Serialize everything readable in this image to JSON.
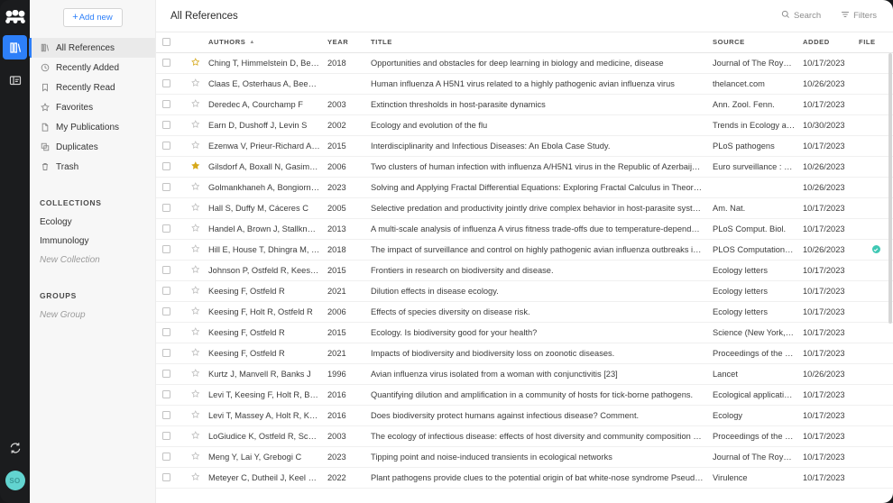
{
  "rail": {
    "logo_icon": "mendeley-logo-icon",
    "buttons": [
      {
        "name": "library-icon",
        "label": "Library",
        "active": true
      },
      {
        "name": "notebook-icon",
        "label": "Notebook",
        "active": false
      }
    ],
    "sync_icon": "sync-icon",
    "avatar_initials": "SO",
    "accent_color": "#2d7ff9",
    "avatar_color": "#62d4d0"
  },
  "sidebar": {
    "add_new_label": "Add new",
    "add_new_plus": "+",
    "nav_items": [
      {
        "label": "All References",
        "icon": "library-icon",
        "selected": true
      },
      {
        "label": "Recently Added",
        "icon": "clock-icon",
        "selected": false
      },
      {
        "label": "Recently Read",
        "icon": "bookmark-icon",
        "selected": false
      },
      {
        "label": "Favorites",
        "icon": "star-icon",
        "selected": false
      },
      {
        "label": "My Publications",
        "icon": "document-icon",
        "selected": false
      },
      {
        "label": "Duplicates",
        "icon": "copy-icon",
        "selected": false
      },
      {
        "label": "Trash",
        "icon": "trash-icon",
        "selected": false
      }
    ],
    "collections_heading": "COLLECTIONS",
    "collections": [
      {
        "label": "Ecology",
        "muted": false
      },
      {
        "label": "Immunology",
        "muted": false
      },
      {
        "label": "New Collection",
        "muted": true
      }
    ],
    "groups_heading": "GROUPS",
    "groups": [
      {
        "label": "New Group",
        "muted": true
      }
    ]
  },
  "topbar": {
    "title": "All References",
    "search_label": "Search",
    "search_icon": "search-icon",
    "filters_label": "Filters",
    "filters_icon": "filter-icon"
  },
  "table": {
    "columns": {
      "authors": "AUTHORS",
      "year": "YEAR",
      "title": "TITLE",
      "source": "SOURCE",
      "added": "ADDED",
      "file": "FILE"
    },
    "sort_column": "AUTHORS",
    "sort_direction": "asc",
    "sort_caret": "▲",
    "rows": [
      {
        "authors": "Ching T, Himmelstein D, Beauli…",
        "year": "2018",
        "title": "Opportunities and obstacles for deep learning in biology and medicine, disease",
        "source": "Journal of The Royal S…",
        "added": "10/17/2023",
        "unread": true,
        "starred": "outline-gold",
        "file": false
      },
      {
        "authors": "Claas E, Osterhaus A, Beek R, …",
        "year": "",
        "title": "Human influenza A H5N1 virus related to a highly pathogenic avian influenza virus",
        "source": "thelancet.com",
        "added": "10/26/2023",
        "unread": true,
        "starred": "outline",
        "file": false
      },
      {
        "authors": "Deredec A, Courchamp F",
        "year": "2003",
        "title": "Extinction thresholds in host-parasite dynamics",
        "source": "Ann. Zool. Fenn.",
        "added": "10/17/2023",
        "unread": true,
        "starred": "outline",
        "file": false
      },
      {
        "authors": "Earn D, Dushoff J, Levin S",
        "year": "2002",
        "title": "Ecology and evolution of the flu",
        "source": "Trends in Ecology and …",
        "added": "10/30/2023",
        "unread": true,
        "starred": "outline",
        "file": false
      },
      {
        "authors": "Ezenwa V, Prieur-Richard A, Ro…",
        "year": "2015",
        "title": "Interdisciplinarity and Infectious Diseases: An Ebola Case Study.",
        "source": "PLoS pathogens",
        "added": "10/17/2023",
        "unread": true,
        "starred": "outline",
        "file": false
      },
      {
        "authors": "Gilsdorf A, Boxall N, Gasimov V…",
        "year": "2006",
        "title": "Two clusters of human infection with influenza A/H5N1 virus in the Republic of Azerbaijan, Febr…",
        "source": "Euro surveillance : bull…",
        "added": "10/26/2023",
        "unread": true,
        "starred": "filled-gold",
        "file": false
      },
      {
        "authors": "Golmankhaneh A, Bongiorno D",
        "year": "2023",
        "title": "Solving and Applying Fractal Differential Equations: Exploring Fractal Calculus in Theory and Pr…",
        "source": "",
        "added": "10/26/2023",
        "unread": true,
        "starred": "outline",
        "file": false
      },
      {
        "authors": "Hall S, Duffy M, Cáceres C",
        "year": "2005",
        "title": "Selective predation and productivity jointly drive complex behavior in host-parasite systems",
        "source": "Am. Nat.",
        "added": "10/17/2023",
        "unread": true,
        "starred": "outline",
        "file": false
      },
      {
        "authors": "Handel A, Brown J, Stallknecht …",
        "year": "2013",
        "title": "A multi-scale analysis of influenza A virus fitness trade-offs due to temperature-dependent virus …",
        "source": "PLoS Comput. Biol.",
        "added": "10/17/2023",
        "unread": true,
        "starred": "outline",
        "file": false
      },
      {
        "authors": "Hill E, House T, Dhingra M, Kal…",
        "year": "2018",
        "title": "The impact of surveillance and control on highly pathogenic avian influenza outbreaks in poultry…",
        "source": "PLOS Computational B…",
        "added": "10/26/2023",
        "unread": true,
        "starred": "outline",
        "file": true
      },
      {
        "authors": "Johnson P, Ostfeld R, Keesing F",
        "year": "2015",
        "title": "Frontiers in research on biodiversity and disease.",
        "source": "Ecology letters",
        "added": "10/17/2023",
        "unread": true,
        "starred": "outline",
        "file": false
      },
      {
        "authors": "Keesing F, Ostfeld R",
        "year": "2021",
        "title": "Dilution effects in disease ecology.",
        "source": "Ecology letters",
        "added": "10/17/2023",
        "unread": true,
        "starred": "outline",
        "file": false
      },
      {
        "authors": "Keesing F, Holt R, Ostfeld R",
        "year": "2006",
        "title": "Effects of species diversity on disease risk.",
        "source": "Ecology letters",
        "added": "10/17/2023",
        "unread": true,
        "starred": "outline",
        "file": false
      },
      {
        "authors": "Keesing F, Ostfeld R",
        "year": "2015",
        "title": "Ecology. Is biodiversity good for your health?",
        "source": "Science (New York, N.Y.)",
        "added": "10/17/2023",
        "unread": true,
        "starred": "outline",
        "file": false
      },
      {
        "authors": "Keesing F, Ostfeld R",
        "year": "2021",
        "title": "Impacts of biodiversity and biodiversity loss on zoonotic diseases.",
        "source": "Proceedings of the Nati…",
        "added": "10/17/2023",
        "unread": true,
        "starred": "outline",
        "file": false
      },
      {
        "authors": "Kurtz J, Manvell R, Banks J",
        "year": "1996",
        "title": "Avian influenza virus isolated from a woman with conjunctivitis [23]",
        "source": "Lancet",
        "added": "10/26/2023",
        "unread": true,
        "starred": "outline",
        "file": false
      },
      {
        "authors": "Levi T, Keesing F, Holt R, Barfie…",
        "year": "2016",
        "title": "Quantifying dilution and amplification in a community of hosts for tick-borne pathogens.",
        "source": "Ecological applications …",
        "added": "10/17/2023",
        "unread": true,
        "starred": "outline",
        "file": false
      },
      {
        "authors": "Levi T, Massey A, Holt R, Keesi…",
        "year": "2016",
        "title": "Does biodiversity protect humans against infectious disease? Comment.",
        "source": "Ecology",
        "added": "10/17/2023",
        "unread": true,
        "starred": "outline",
        "file": false
      },
      {
        "authors": "LoGiudice K, Ostfeld R, Schmid…",
        "year": "2003",
        "title": "The ecology of infectious disease: effects of host diversity and community composition on Lyme…",
        "source": "Proceedings of the Nati…",
        "added": "10/17/2023",
        "unread": true,
        "starred": "outline",
        "file": false
      },
      {
        "authors": "Meng Y, Lai Y, Grebogi C",
        "year": "2023",
        "title": "Tipping point and noise-induced transients in ecological networks",
        "source": "Journal of The Royal S…",
        "added": "10/17/2023",
        "unread": true,
        "starred": "outline",
        "file": false
      },
      {
        "authors": "Meteyer C, Dutheil J, Keel M, B…",
        "year": "2022",
        "title": "Plant pathogens provide clues to the potential origin of bat white-nose syndrome Pseudogymno…",
        "source": "Virulence",
        "added": "10/17/2023",
        "unread": true,
        "starred": "outline",
        "file": false
      }
    ]
  }
}
